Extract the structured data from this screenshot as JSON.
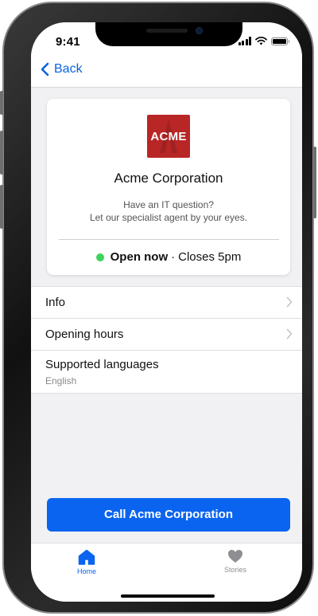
{
  "status_bar": {
    "time": "9:41"
  },
  "nav": {
    "back_label": "Back"
  },
  "card": {
    "logo_text": "ACME",
    "company_name": "Acme Corporation",
    "tagline_line1": "Have an IT question?",
    "tagline_line2": "Let our specialist agent by your eyes.",
    "open_label": "Open now",
    "separator": "·",
    "closes_label": "Closes 5pm",
    "open_color": "#3ED35C"
  },
  "list": {
    "items": [
      {
        "label": "Info"
      },
      {
        "label": "Opening hours"
      },
      {
        "label": "Supported languages",
        "sub": "English"
      }
    ]
  },
  "cta": {
    "call_label": "Call Acme Corporation"
  },
  "tabbar": {
    "tabs": [
      {
        "label": "Home",
        "icon": "home-icon",
        "active": true
      },
      {
        "label": "Stories",
        "icon": "heart-icon",
        "active": false
      }
    ]
  },
  "colors": {
    "accent": "#0A64F0",
    "brand_red": "#B82626",
    "inactive_tab": "#8E8E93"
  }
}
